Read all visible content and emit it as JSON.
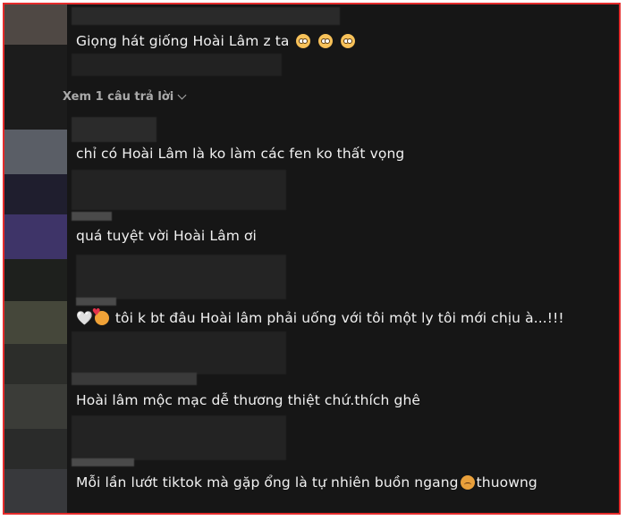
{
  "comments": [
    {
      "text": "Giọng hát giống Hoài Lâm z ta",
      "emoji": [
        "flushed-face",
        "flushed-face",
        "flushed-face"
      ]
    },
    {
      "text": "chỉ có Hoài Lâm là ko làm các fen ko thất vọng"
    },
    {
      "text": "quá tuyệt vời Hoài Lâm ơi"
    },
    {
      "prefix": "🤍",
      "text": "tôi k bt đâu Hoài lâm phải uống với tôi một ly tôi mới chịu à...!!!"
    },
    {
      "text": "Hoài lâm mộc mạc dễ thương thiệt chứ.thích ghê"
    },
    {
      "text": "Mỗi lần lướt tiktok mà gặp ổng là tự nhiên buồn ngang",
      "suffix": "thuowng"
    }
  ],
  "reply_link": "Xem 1 câu trả lời",
  "colors": {
    "frame_border": "#e52b2b",
    "background": "#161616",
    "text": "#f1f1f1",
    "muted": "#aaaaaa"
  }
}
